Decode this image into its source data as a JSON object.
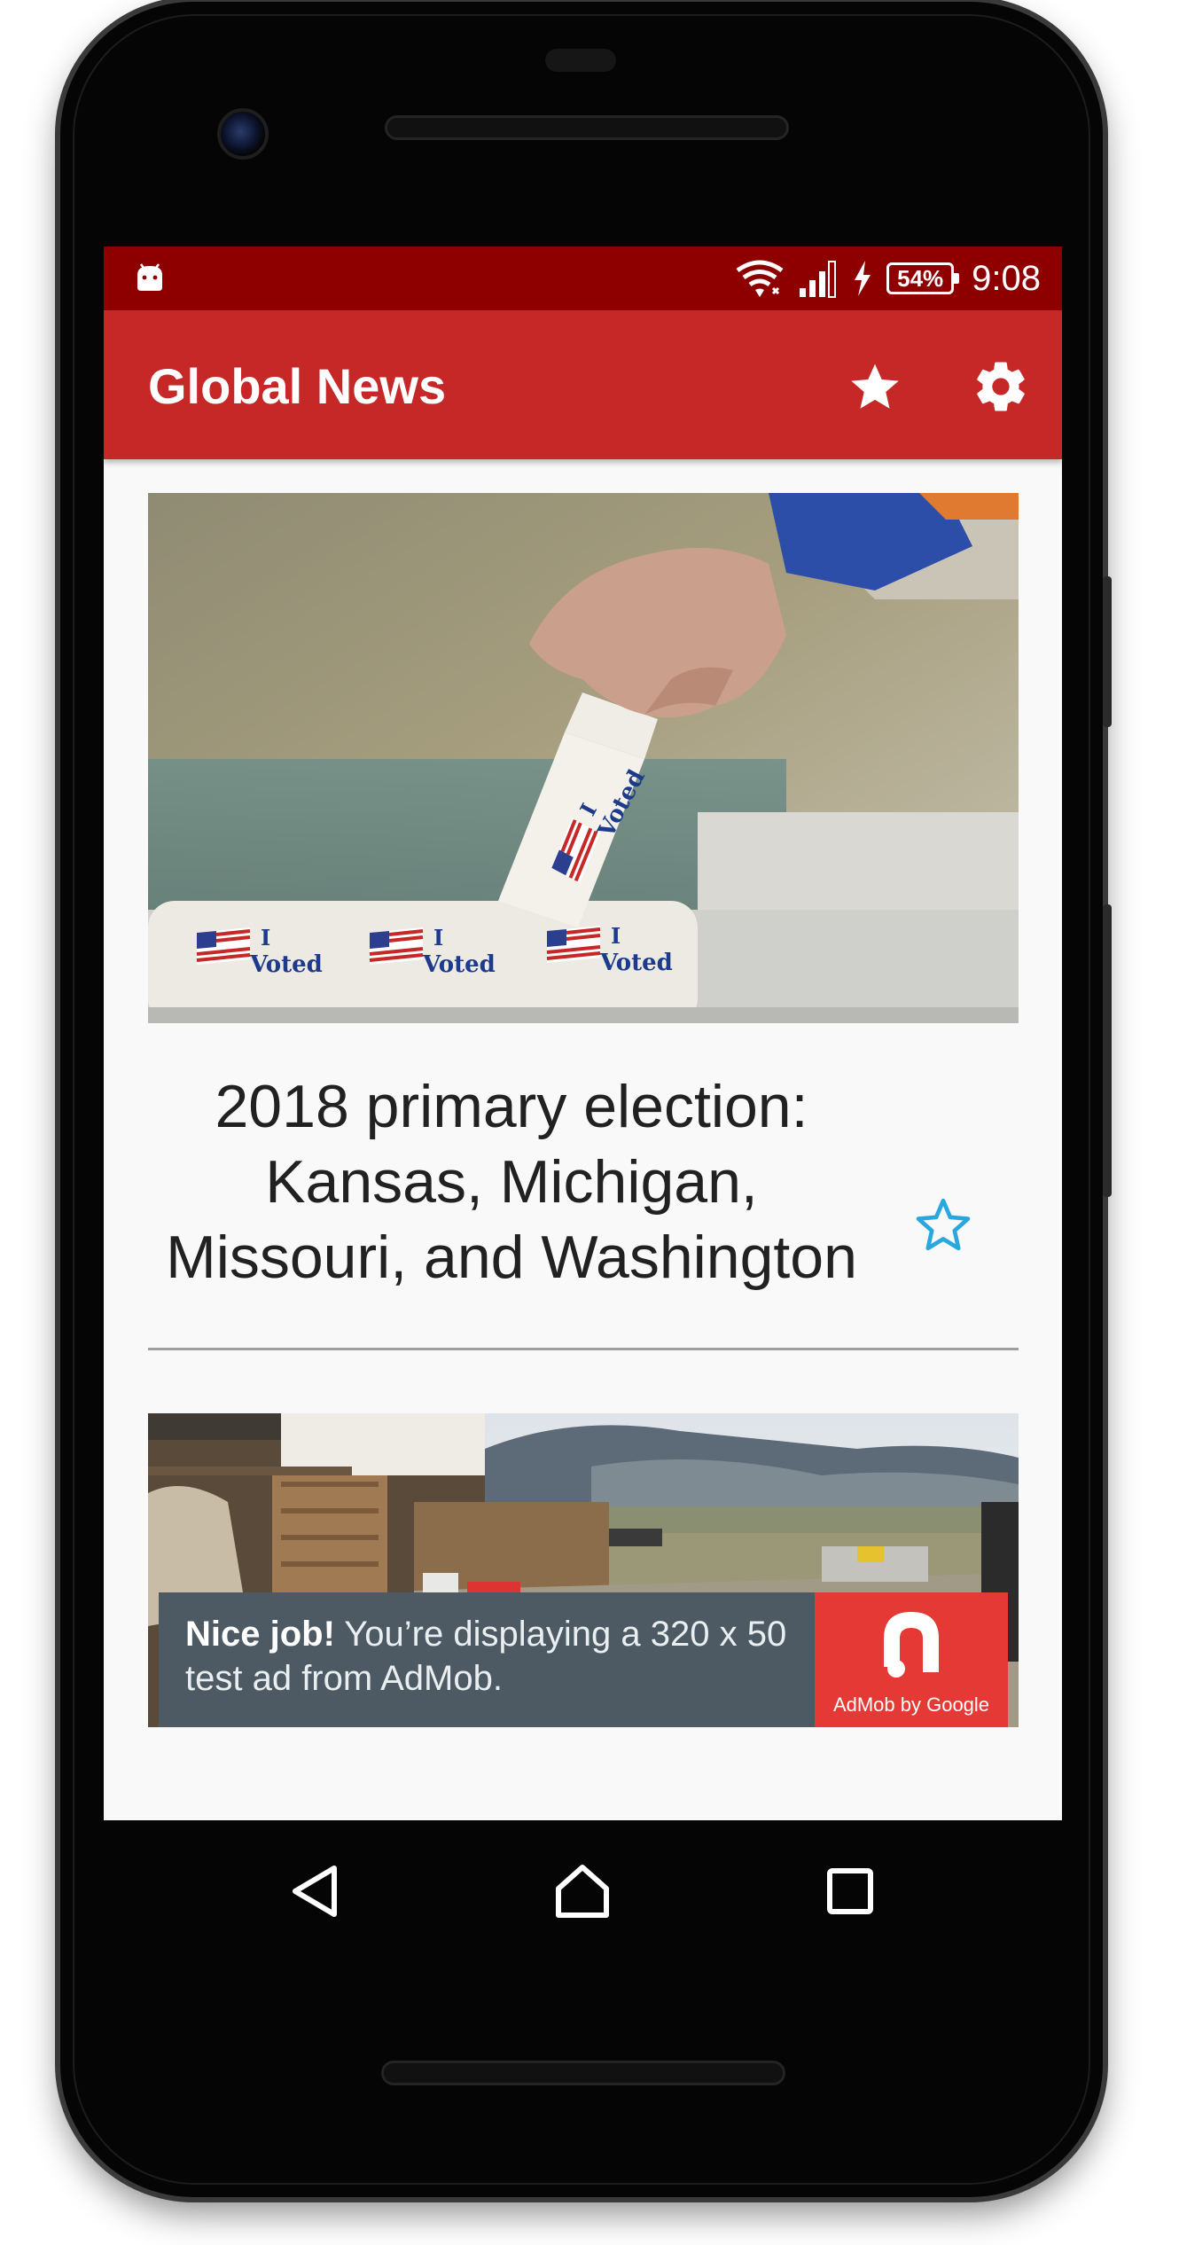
{
  "status_bar": {
    "time": "9:08",
    "battery": "54%",
    "icons": [
      "android-icon",
      "wifi-icon",
      "signal-icon",
      "charging-icon",
      "battery-icon"
    ]
  },
  "app_bar": {
    "title": "Global News",
    "actions": [
      {
        "icon": "star-icon",
        "label": "Favorites"
      },
      {
        "icon": "gear-icon",
        "label": "Settings"
      }
    ]
  },
  "articles": [
    {
      "title": "2018 primary election: Kansas, Michigan, Missouri, and Washington",
      "image_text": [
        "I",
        "Voted",
        "I",
        "Voted",
        "I",
        "Voted",
        "I",
        "Voted"
      ],
      "favorite_icon": "star-outline-icon",
      "favorited": false
    },
    {
      "title": "",
      "image": "compound-landscape"
    }
  ],
  "ad": {
    "headline": "Nice job!",
    "body": "You’re displaying a 320 x 50 test ad from AdMob.",
    "brand": "AdMob by Google"
  },
  "navigation": {
    "buttons": [
      "back-icon",
      "home-icon",
      "recents-icon"
    ]
  },
  "colors": {
    "status_bar": "#8e0000",
    "app_bar": "#c62828",
    "accent_star": "#29a8e0",
    "ad_background": "#4d5a63",
    "ad_logo": "#e53935"
  }
}
